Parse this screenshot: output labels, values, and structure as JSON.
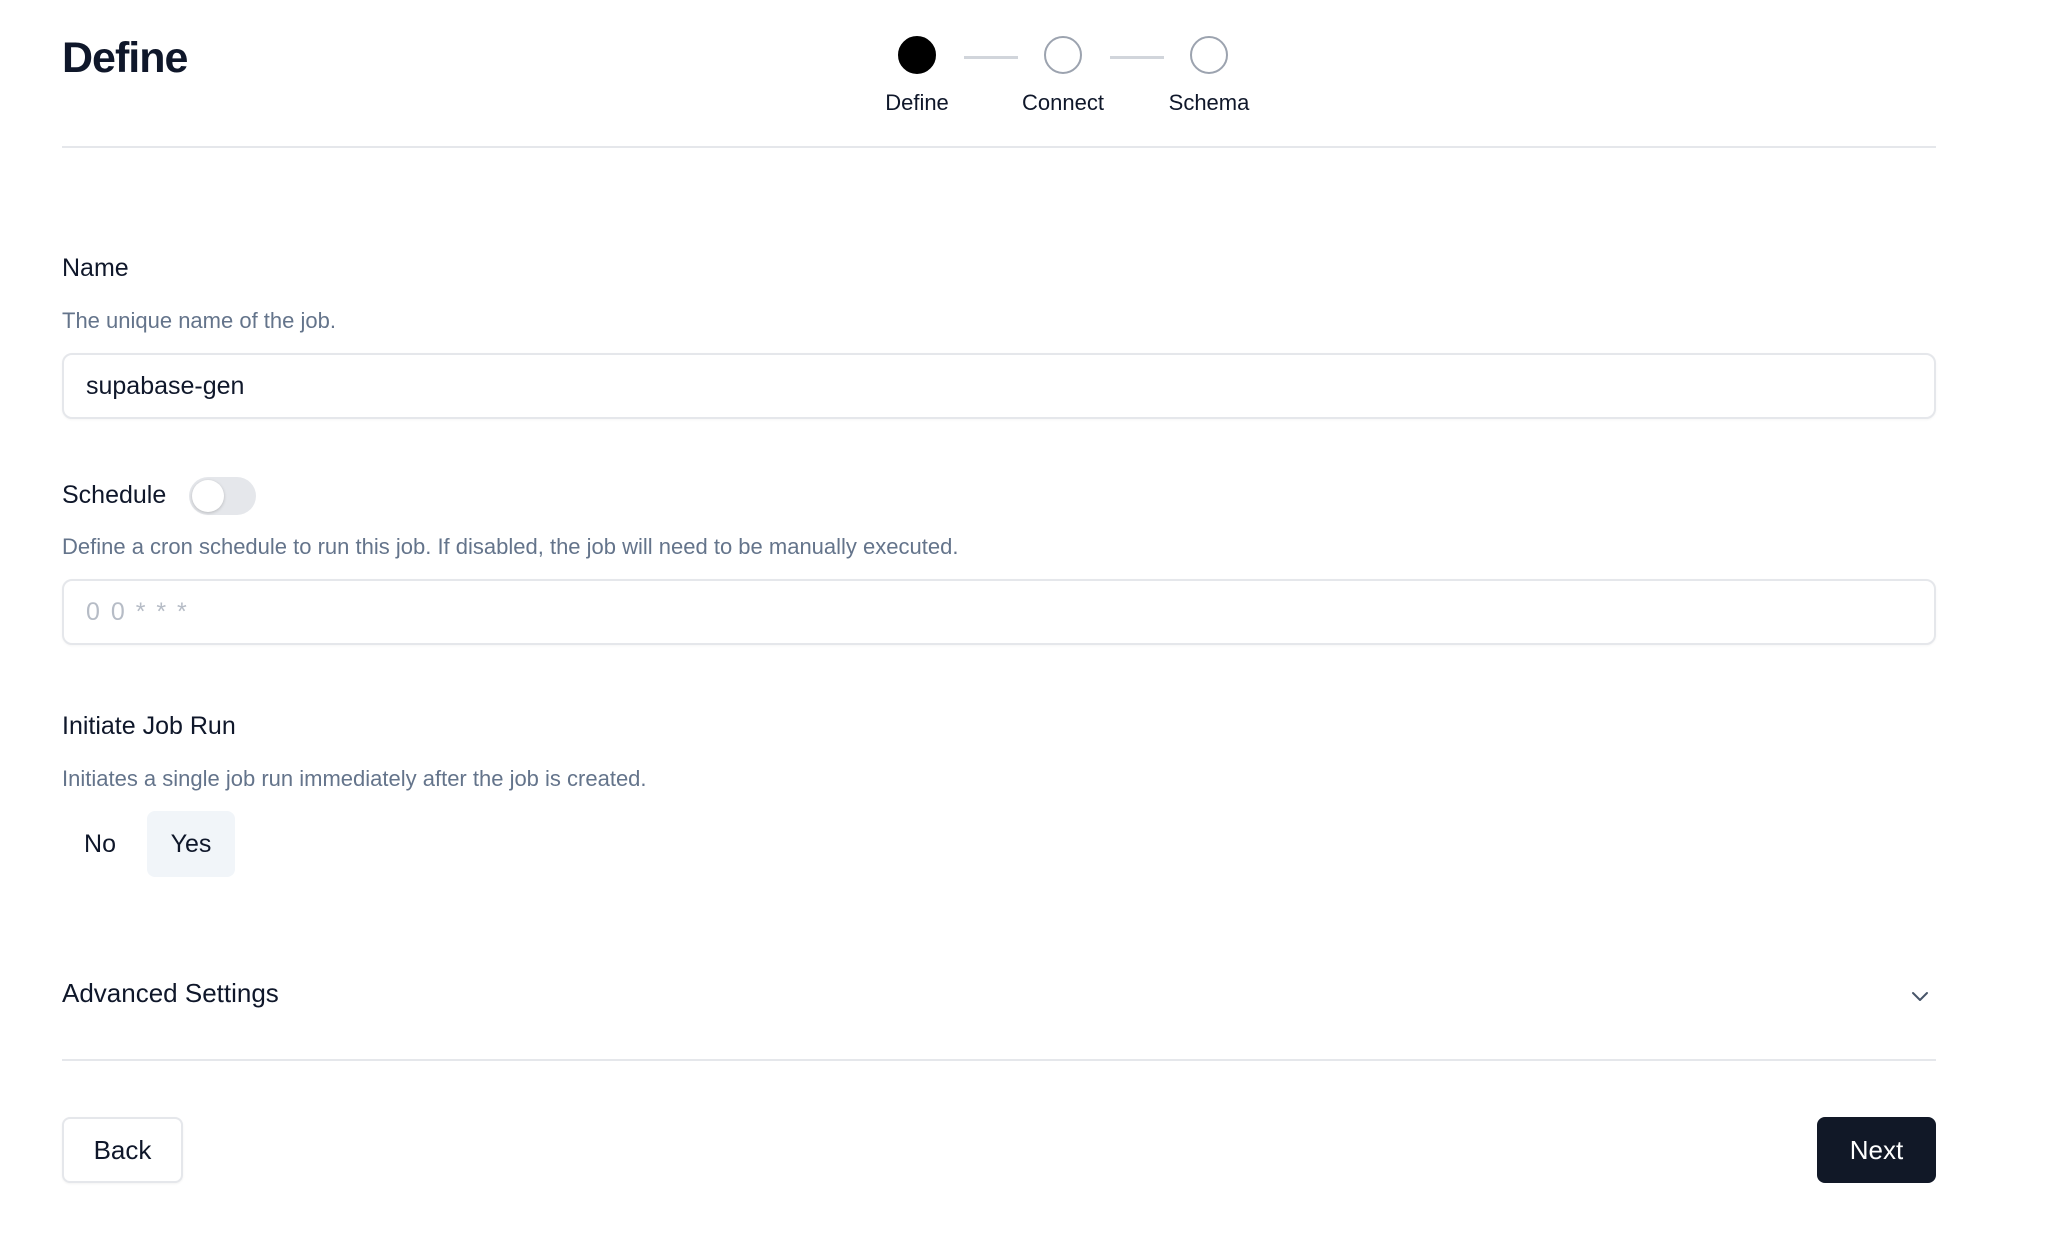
{
  "header": {
    "title": "Define"
  },
  "stepper": {
    "steps": [
      {
        "label": "Define",
        "state": "active"
      },
      {
        "label": "Connect",
        "state": "pending"
      },
      {
        "label": "Schema",
        "state": "pending"
      }
    ]
  },
  "name_field": {
    "label": "Name",
    "description": "The unique name of the job.",
    "value": "supabase-gen"
  },
  "schedule_field": {
    "label": "Schedule",
    "toggle_on": false,
    "description": "Define a cron schedule to run this job. If disabled, the job will need to be manually executed.",
    "placeholder": "0 0 * * *"
  },
  "initiate_field": {
    "label": "Initiate Job Run",
    "description": "Initiates a single job run immediately after the job is created.",
    "options": [
      "No",
      "Yes"
    ],
    "selected": "Yes"
  },
  "advanced": {
    "label": "Advanced Settings",
    "icon": "chevron-down-icon"
  },
  "footer": {
    "back_label": "Back",
    "next_label": "Next"
  },
  "colors": {
    "primary": "#111827",
    "muted_text": "#64748b",
    "border": "#e5e7eb",
    "selected_bg": "#f1f5f9"
  }
}
